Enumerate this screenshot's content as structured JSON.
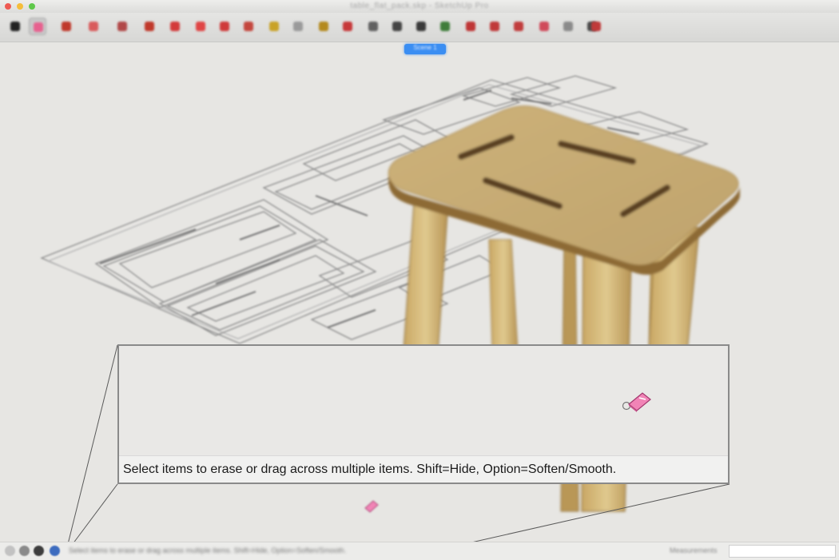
{
  "window": {
    "title": "table_flat_pack.skp - SketchUp Pro",
    "controls": {
      "close_color": "#ee5a52",
      "minimize_color": "#f5bd3a",
      "zoom_color": "#5fc84a"
    }
  },
  "toolbar": {
    "tools": [
      {
        "name": "select-tool",
        "color": "#222222",
        "active": false
      },
      {
        "name": "eraser-tool",
        "color": "#e7618f",
        "active": true
      },
      {
        "name": "pencil-tool",
        "color": "#c0392b",
        "active": false
      },
      {
        "name": "arc-tool",
        "color": "#d95b5b",
        "active": false
      },
      {
        "name": "rectangle-tool",
        "color": "#b14848",
        "active": false
      },
      {
        "name": "push-pull-tool",
        "color": "#c0392b",
        "active": false
      },
      {
        "name": "move-tool",
        "color": "#d33a3a",
        "active": false
      },
      {
        "name": "rotate-tool",
        "color": "#e04545",
        "active": false
      },
      {
        "name": "scale-tool",
        "color": "#cf3b3b",
        "active": false
      },
      {
        "name": "offset-tool",
        "color": "#c4473e",
        "active": false
      },
      {
        "name": "tape-measure-tool",
        "color": "#c9a227",
        "active": false
      },
      {
        "name": "dimension-tool",
        "color": "#9a9a9a",
        "active": false
      },
      {
        "name": "paint-bucket-tool",
        "color": "#b48a1e",
        "active": false
      },
      {
        "name": "orbit-tool",
        "color": "#c7393a",
        "active": false
      },
      {
        "name": "pan-tool",
        "color": "#606060",
        "active": false
      },
      {
        "name": "zoom-tool",
        "color": "#444444",
        "active": false
      },
      {
        "name": "zoom-extents-tool",
        "color": "#3a3a3a",
        "active": false
      },
      {
        "name": "components-tool",
        "color": "#3f7d3a",
        "active": false
      },
      {
        "name": "materials-tool",
        "color": "#bf3636",
        "active": false
      },
      {
        "name": "styles-tool",
        "color": "#c03a3a",
        "active": false
      },
      {
        "name": "warehouse-tool",
        "color": "#c13d3d",
        "active": false
      },
      {
        "name": "extension-warehouse-tool",
        "color": "#d04a5a",
        "active": false
      },
      {
        "name": "layout-tool",
        "color": "#8a8a8a",
        "active": false
      },
      {
        "name": "extension-manager-tool",
        "color": "#4a4a4a",
        "active": false
      },
      {
        "name": "sandbox-tool",
        "color": "#c03a3a",
        "active": false
      }
    ]
  },
  "scene_tab": {
    "label": "Scene 1"
  },
  "callout": {
    "status_text": "Select items to erase or drag across multiple items. Shift=Hide, Option=Soften/Smooth."
  },
  "statusbar": {
    "instruction": "Select items to erase or drag across multiple items. Shift=Hide, Option=Soften/Smooth.",
    "measurements_label": "Measurements",
    "measurements_value": ""
  }
}
